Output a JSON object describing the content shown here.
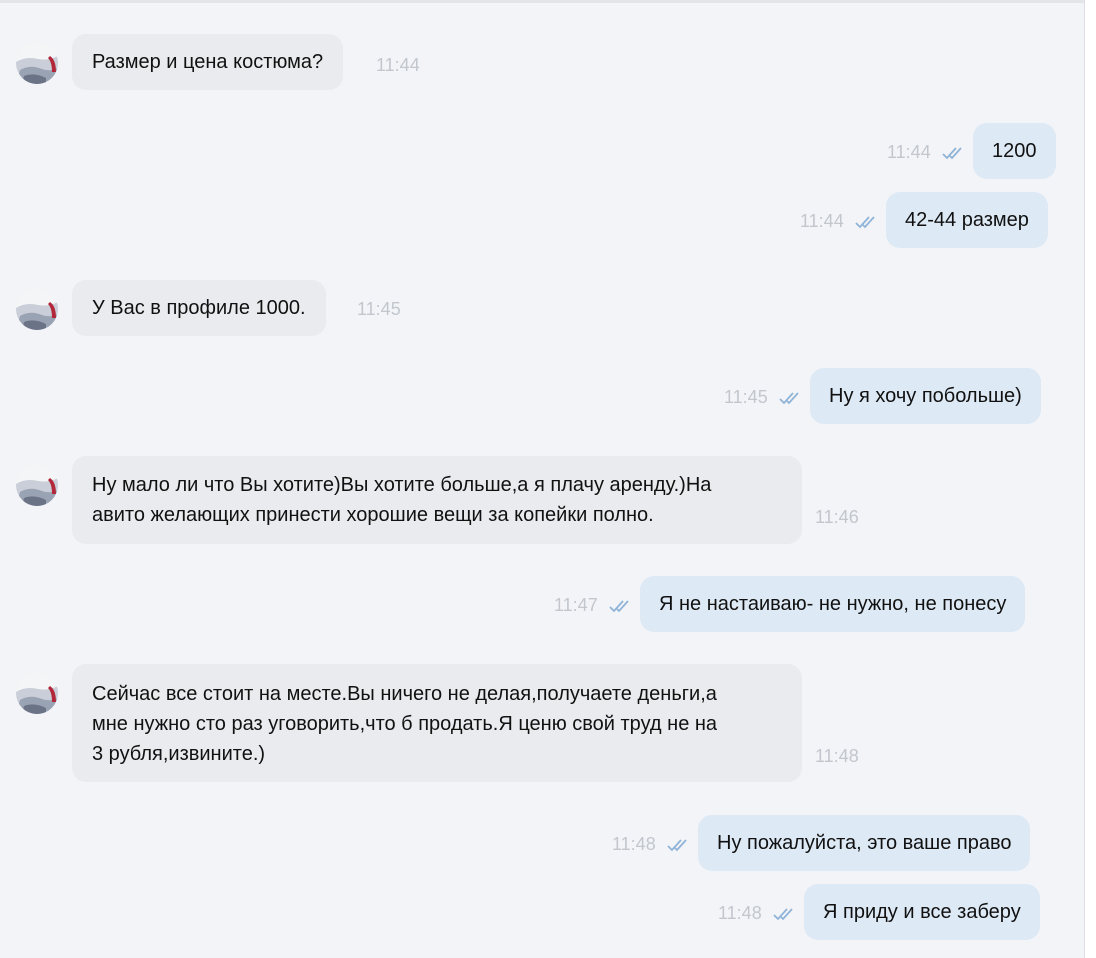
{
  "colors": {
    "background": "#f3f4f7",
    "incoming_bubble": "#eaebee",
    "outgoing_bubble": "#dde9f5",
    "timestamp": "#c2c7ce",
    "read_check": "#8fb4d8"
  },
  "icons": {
    "avatar": "user-avatar",
    "read_status": "double-check-icon"
  },
  "messages": [
    {
      "direction": "incoming",
      "text": "Размер и цена костюма?",
      "time": "11:44"
    },
    {
      "direction": "outgoing",
      "text": "1200",
      "time": "11:44",
      "status": "read"
    },
    {
      "direction": "outgoing",
      "text": "42-44 размер",
      "time": "11:44",
      "status": "read"
    },
    {
      "direction": "incoming",
      "text": "У Вас в профиле 1000.",
      "time": "11:45"
    },
    {
      "direction": "outgoing",
      "text": "Ну я хочу побольше)",
      "time": "11:45",
      "status": "read"
    },
    {
      "direction": "incoming",
      "lines": [
        "Ну мало ли что Вы хотите)Вы хотите больше,а я плачу аренду.)На",
        "авито желающих принести хорошие вещи за копейки полно."
      ],
      "time": "11:46"
    },
    {
      "direction": "outgoing",
      "text": "Я не настаиваю- не нужно, не понесу",
      "time": "11:47",
      "status": "read"
    },
    {
      "direction": "incoming",
      "lines": [
        "Сейчас все стоит на месте.Вы ничего не делая,получаете деньги,а",
        "мне нужно сто раз уговорить,что б продать.Я ценю свой труд не на",
        "3 рубля,извините.)"
      ],
      "time": "11:48"
    },
    {
      "direction": "outgoing",
      "text": "Ну пожалуйста, это ваше право",
      "time": "11:48",
      "status": "read"
    },
    {
      "direction": "outgoing",
      "text": "Я приду и все заберу",
      "time": "11:48",
      "status": "read"
    }
  ]
}
